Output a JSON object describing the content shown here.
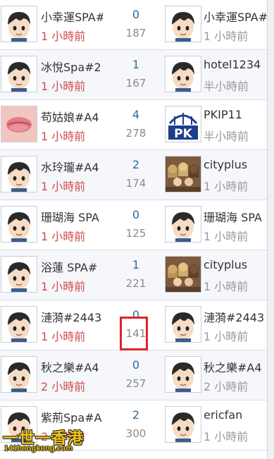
{
  "rows": [
    {
      "author": "小幸運SPA#",
      "author_time": "1 小時前",
      "replies": "0",
      "views": "187",
      "last_poster": "小幸運SPA#",
      "last_time": "1 小時前",
      "author_avatar": "cartoon-boy",
      "last_avatar": "cartoon-boy"
    },
    {
      "author": "冰悅Spa#2",
      "author_time": "1 小時前",
      "replies": "1",
      "views": "167",
      "last_poster": "hotel1234",
      "last_time": "半小時前",
      "author_avatar": "cartoon-boy",
      "last_avatar": "cartoon-boy"
    },
    {
      "author": "苟姑娘#A4",
      "author_time": "1 小時前",
      "replies": "4",
      "views": "278",
      "last_poster": "PKIP11",
      "last_time": "半小時前",
      "author_avatar": "lips-photo",
      "last_avatar": "pk-logo"
    },
    {
      "author": "水玲瓏#A4",
      "author_time": "1 小時前",
      "replies": "2",
      "views": "174",
      "last_poster": "cityplus",
      "last_time": "1 小時前",
      "author_avatar": "cartoon-boy",
      "last_avatar": "group-photo"
    },
    {
      "author": "珊瑚海 SPA",
      "author_time": "1 小時前",
      "replies": "0",
      "views": "125",
      "last_poster": "珊瑚海 SPA",
      "last_time": "1 小時前",
      "author_avatar": "cartoon-boy",
      "last_avatar": "cartoon-boy"
    },
    {
      "author": "浴蓮 SPA#",
      "author_time": "1 小時前",
      "replies": "1",
      "views": "221",
      "last_poster": "cityplus",
      "last_time": "1 小時前",
      "author_avatar": "cartoon-boy",
      "last_avatar": "group-photo"
    },
    {
      "author": "漣漪#2443",
      "author_time": "1 小時前",
      "replies": "0",
      "views": "141",
      "last_poster": "漣漪#2443",
      "last_time": "1 小時前",
      "author_avatar": "cartoon-boy",
      "last_avatar": "cartoon-boy"
    },
    {
      "author": "秋之樂#A4",
      "author_time": "2 小時前",
      "replies": "0",
      "views": "257",
      "last_poster": "秋之樂#A4",
      "last_time": "2 小時前",
      "author_avatar": "cartoon-boy",
      "last_avatar": "cartoon-boy"
    },
    {
      "author": "紫荊Spa#A",
      "author_time": "2 小時前",
      "replies": "2",
      "views": "300",
      "last_poster": "ericfan",
      "last_time": "1 小時前",
      "author_avatar": "cartoon-boy",
      "last_avatar": "cartoon-boy"
    }
  ],
  "pk_logo_text": "PK",
  "watermark": {
    "main": "一世一香港",
    "sub": "141hongkong.com"
  },
  "colors": {
    "recent_time": "#d24c4c",
    "old_time": "#9a9a9a",
    "replies": "#2f6a94",
    "highlight": "#e0232d"
  }
}
